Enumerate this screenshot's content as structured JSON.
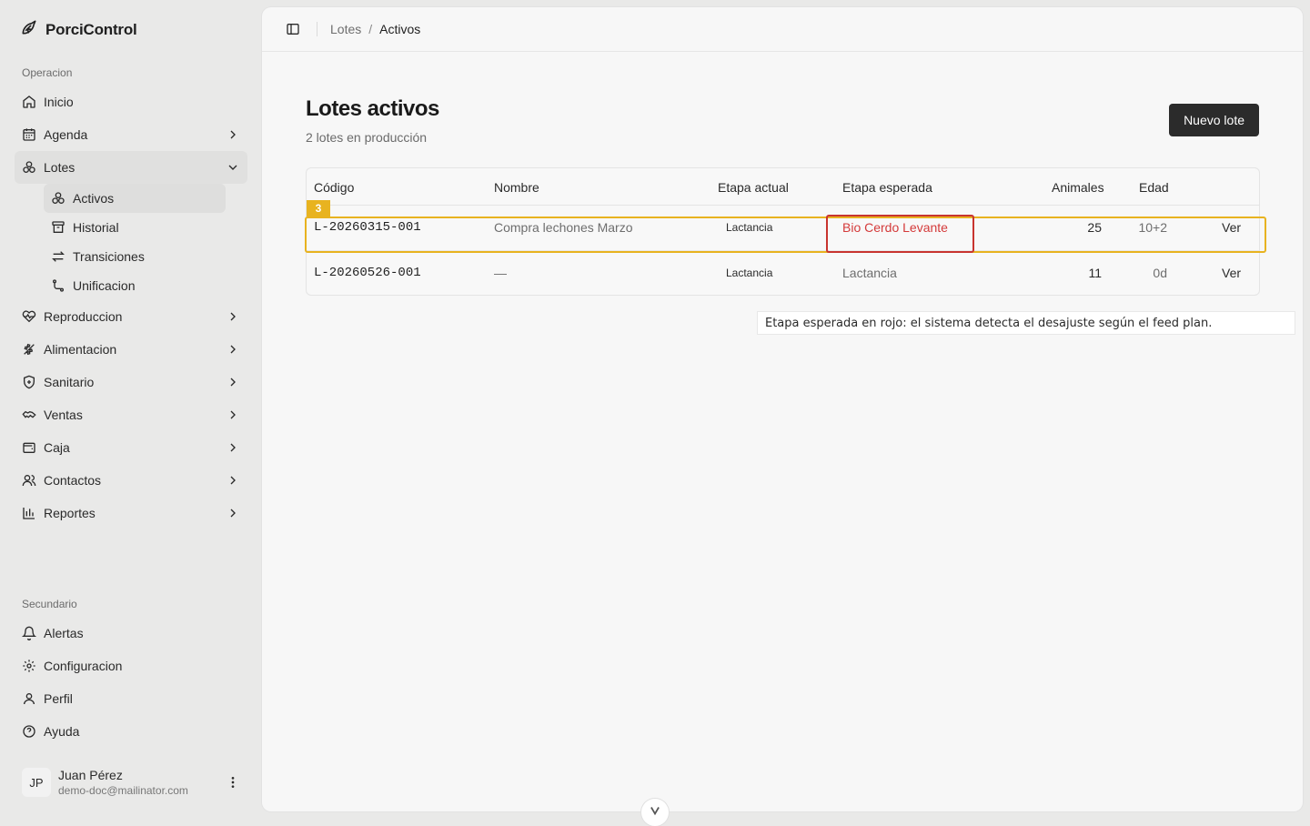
{
  "app": {
    "name": "PorciControl"
  },
  "sidebar": {
    "group_operacion": "Operacion",
    "items": [
      {
        "label": "Inicio"
      },
      {
        "label": "Agenda"
      },
      {
        "label": "Lotes"
      },
      {
        "label": "Reproduccion"
      },
      {
        "label": "Alimentacion"
      },
      {
        "label": "Sanitario"
      },
      {
        "label": "Ventas"
      },
      {
        "label": "Caja"
      },
      {
        "label": "Contactos"
      },
      {
        "label": "Reportes"
      }
    ],
    "lotes_sub": [
      {
        "label": "Activos"
      },
      {
        "label": "Historial"
      },
      {
        "label": "Transiciones"
      },
      {
        "label": "Unificacion"
      }
    ],
    "group_secundario": "Secundario",
    "secondary": [
      {
        "label": "Alertas"
      },
      {
        "label": "Configuracion"
      },
      {
        "label": "Perfil"
      },
      {
        "label": "Ayuda"
      }
    ],
    "user": {
      "initials": "JP",
      "name": "Juan Pérez",
      "email": "demo-doc@mailinator.com"
    }
  },
  "breadcrumb": {
    "parent": "Lotes",
    "sep": "/",
    "current": "Activos"
  },
  "page": {
    "title": "Lotes activos",
    "subtitle": "2 lotes en producción",
    "new_button": "Nuevo lote"
  },
  "table": {
    "headers": {
      "codigo": "Código",
      "nombre": "Nombre",
      "etapa_actual": "Etapa actual",
      "etapa_esperada": "Etapa esperada",
      "animales": "Animales",
      "edad": "Edad"
    },
    "rows": [
      {
        "codigo": "L-20260315-001",
        "nombre": "Compra lechones Marzo",
        "etapa_actual": "Lactancia",
        "etapa_esperada": "Bio Cerdo Levante",
        "animales": "25",
        "edad": "10+2",
        "action": "Ver"
      },
      {
        "codigo": "L-20260526-001",
        "nombre": "—",
        "etapa_actual": "Lactancia",
        "etapa_esperada": "Lactancia",
        "animales": "11",
        "edad": "0d",
        "action": "Ver"
      }
    ]
  },
  "annotation": {
    "badge": "3",
    "note": "Etapa esperada en rojo: el sistema detecta el desajuste según el feed plan.",
    "row_color": "#e8b320",
    "cell_color": "#c8342f"
  },
  "colors": {
    "mismatch_text": "#d43a3a",
    "primary_button": "#2b2b2b"
  }
}
